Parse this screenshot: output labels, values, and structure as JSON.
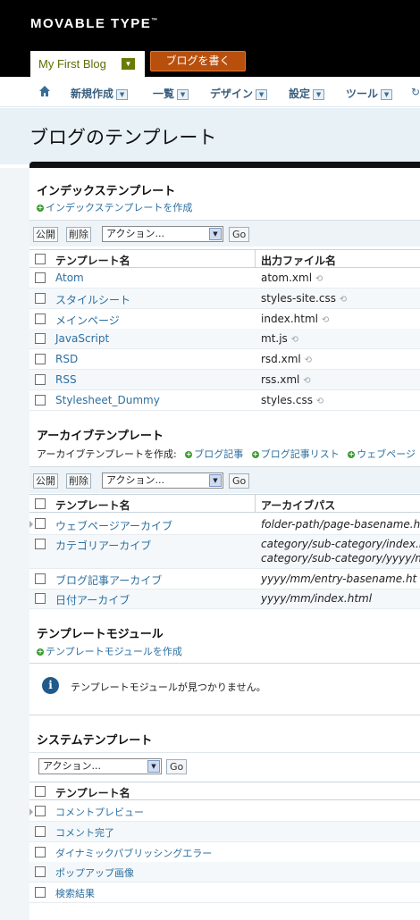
{
  "brand": {
    "logo": "MOVABLE TYPE",
    "tm": "™"
  },
  "blog_selector": {
    "label": "My First Blog"
  },
  "write_button": "ブログを書く",
  "nav": {
    "items": [
      "新規作成",
      "一覧",
      "デザイン",
      "設定",
      "ツール"
    ]
  },
  "page_title": "ブログのテンプレート",
  "actions": {
    "publish": "公開",
    "delete": "削除",
    "select": "アクション...",
    "go": "Go"
  },
  "index": {
    "title": "インデックステンプレート",
    "create_link": "インデックステンプレートを作成",
    "headers": [
      "テンプレート名",
      "出力ファイル名"
    ],
    "rows": [
      {
        "name": "Atom",
        "file": "atom.xml"
      },
      {
        "name": "スタイルシート",
        "file": "styles-site.css"
      },
      {
        "name": "メインページ",
        "file": "index.html"
      },
      {
        "name": "JavaScript",
        "file": "mt.js"
      },
      {
        "name": "RSD",
        "file": "rsd.xml"
      },
      {
        "name": "RSS",
        "file": "rss.xml"
      },
      {
        "name": "Stylesheet_Dummy",
        "file": "styles.css"
      }
    ]
  },
  "archive": {
    "title": "アーカイブテンプレート",
    "create_label": "アーカイブテンプレートを作成:",
    "create_links": [
      "ブログ記事",
      "ブログ記事リスト",
      "ウェブページ"
    ],
    "headers": [
      "テンプレート名",
      "アーカイブパス"
    ],
    "rows": [
      {
        "name": "ウェブページアーカイブ",
        "path": "folder-path/page-basename.h",
        "path2": ""
      },
      {
        "name": "カテゴリアーカイブ",
        "path": "category/sub-category/index.h",
        "path2": "category/sub-category/yyyy/m"
      },
      {
        "name": "ブログ記事アーカイブ",
        "path": "yyyy/mm/entry-basename.ht",
        "path2": ""
      },
      {
        "name": "日付アーカイブ",
        "path": "yyyy/mm/index.html",
        "path2": ""
      }
    ]
  },
  "modules": {
    "title": "テンプレートモジュール",
    "create_link": "テンプレートモジュールを作成",
    "empty_message": "テンプレートモジュールが見つかりません。"
  },
  "system": {
    "title": "システムテンプレート",
    "headers": [
      "テンプレート名"
    ],
    "rows": [
      "コメントプレビュー",
      "コメント完了",
      "ダイナミックパブリッシングエラー",
      "ポップアップ画像",
      "検索結果"
    ]
  }
}
